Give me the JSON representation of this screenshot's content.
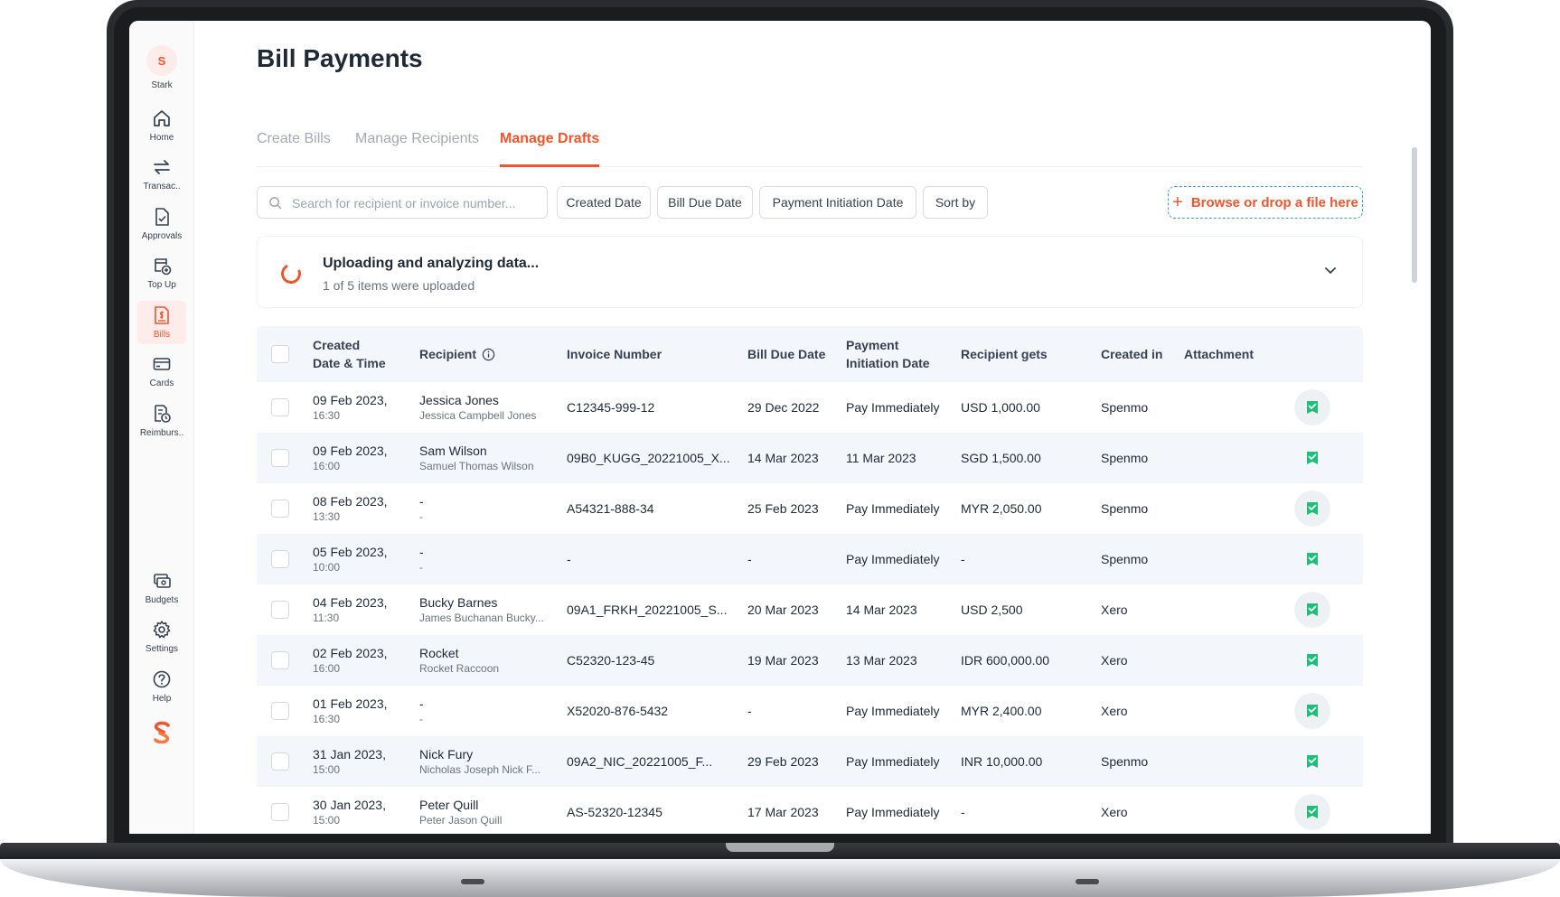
{
  "sidebar": {
    "user": {
      "initial": "S",
      "name": "Stark"
    },
    "items": [
      {
        "label": "Home",
        "icon": "home-icon"
      },
      {
        "label": "Transac..",
        "icon": "transfer-icon"
      },
      {
        "label": "Approvals",
        "icon": "approval-document-icon"
      },
      {
        "label": "Top Up",
        "icon": "top-up-icon"
      },
      {
        "label": "Bills",
        "icon": "bills-icon",
        "active": true
      },
      {
        "label": "Cards",
        "icon": "card-icon"
      },
      {
        "label": "Reimburs..",
        "icon": "reimbursement-icon"
      }
    ],
    "bottom_items": [
      {
        "label": "Budgets",
        "icon": "budgets-icon"
      },
      {
        "label": "Settings",
        "icon": "gear-icon"
      },
      {
        "label": "Help",
        "icon": "help-icon"
      }
    ],
    "logo": "spenmo-logo"
  },
  "header": {
    "title": "Bill Payments"
  },
  "tabs": [
    {
      "label": "Create Bills"
    },
    {
      "label": "Manage Recipients"
    },
    {
      "label": "Manage Drafts",
      "active": true
    }
  ],
  "filters": {
    "search_placeholder": "Search for recipient or invoice number...",
    "chips": [
      "Created Date",
      "Bill Due Date",
      "Payment Initiation Date",
      "Sort by"
    ],
    "upload_label": "Browse or drop a file here"
  },
  "upload_status": {
    "title": "Uploading and analyzing data...",
    "subtitle": "1 of 5 items were uploaded"
  },
  "table": {
    "headers": {
      "created": [
        "Created",
        "Date & Time"
      ],
      "recipient": "Recipient",
      "invoice": "Invoice Number",
      "due": "Bill Due Date",
      "payment": [
        "Payment",
        "Initiation Date"
      ],
      "gets": "Recipient gets",
      "created_in": "Created in",
      "attachment": "Attachment"
    },
    "rows": [
      {
        "date": "09 Feb 2023,",
        "time": "16:30",
        "recipient": "Jessica Jones",
        "recipient_full": "Jessica Campbell Jones",
        "invoice": "C12345-999-12",
        "due": "29 Dec 2022",
        "payment": "Pay Immediately",
        "gets": "USD 1,000.00",
        "created_in": "Spenmo"
      },
      {
        "date": "09 Feb 2023,",
        "time": "16:00",
        "recipient": "Sam Wilson",
        "recipient_full": "Samuel Thomas Wilson",
        "invoice": "09B0_KUGG_20221005_X...",
        "due": "14 Mar 2023",
        "payment": "11 Mar 2023",
        "gets": "SGD 1,500.00",
        "created_in": "Spenmo"
      },
      {
        "date": "08 Feb 2023,",
        "time": "13:30",
        "recipient": "-",
        "recipient_full": "-",
        "invoice": "A54321-888-34",
        "due": "25 Feb 2023",
        "payment": "Pay Immediately",
        "gets": "MYR 2,050.00",
        "created_in": "Spenmo"
      },
      {
        "date": "05 Feb 2023,",
        "time": "10:00",
        "recipient": "-",
        "recipient_full": "-",
        "invoice": "-",
        "due": "-",
        "payment": "Pay Immediately",
        "gets": "-",
        "created_in": "Spenmo"
      },
      {
        "date": "04 Feb 2023,",
        "time": "11:30",
        "recipient": "Bucky Barnes",
        "recipient_full": "James Buchanan Bucky...",
        "invoice": "09A1_FRKH_20221005_S...",
        "due": "20 Mar 2023",
        "payment": "14 Mar 2023",
        "gets": "USD 2,500",
        "created_in": "Xero"
      },
      {
        "date": "02 Feb 2023,",
        "time": "16:00",
        "recipient": "Rocket",
        "recipient_full": "Rocket Raccoon",
        "invoice": "C52320-123-45",
        "due": "19 Mar  2023",
        "payment": "13  Mar 2023",
        "gets": "IDR 600,000.00",
        "created_in": "Xero"
      },
      {
        "date": "01 Feb 2023,",
        "time": "16:30",
        "recipient": "-",
        "recipient_full": "-",
        "invoice": "X52020-876-5432",
        "due": "-",
        "payment": "Pay Immediately",
        "gets": "MYR 2,400.00",
        "created_in": "Xero"
      },
      {
        "date": "31 Jan 2023,",
        "time": "15:00",
        "recipient": "Nick Fury",
        "recipient_full": "Nicholas Joseph Nick F...",
        "invoice": "09A2_NIC_20221005_F...",
        "due": "29 Feb 2023",
        "payment": "Pay Immediately",
        "gets": "INR 10,000.00",
        "created_in": "Spenmo"
      },
      {
        "date": "30 Jan 2023,",
        "time": "15:00",
        "recipient": "Peter Quill",
        "recipient_full": "Peter Jason Quill",
        "invoice": "AS-52320-12345",
        "due": "17 Mar 2023",
        "payment": "Pay Immediately",
        "gets": "-",
        "created_in": "Xero"
      }
    ]
  },
  "colors": {
    "accent": "#f2542d",
    "attachment": "#1fbf7a",
    "upload_border": "#3aa0d5"
  }
}
